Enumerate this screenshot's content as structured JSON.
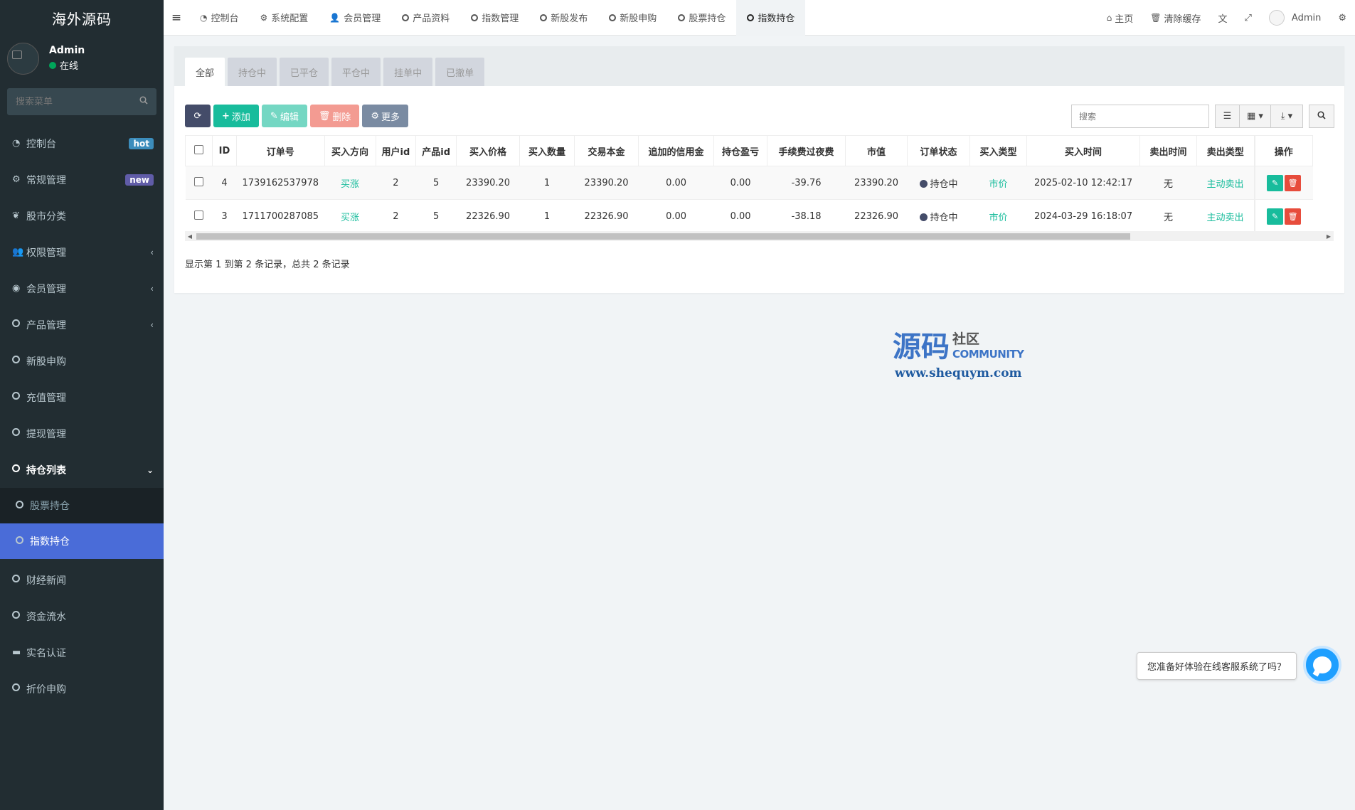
{
  "app": {
    "logo": "海外源码"
  },
  "user": {
    "name": "Admin",
    "status": "在线"
  },
  "sidebar": {
    "search_placeholder": "搜索菜单",
    "items": [
      {
        "label": "控制台",
        "badge": "hot"
      },
      {
        "label": "常规管理",
        "badge": "new"
      },
      {
        "label": "股市分类"
      },
      {
        "label": "权限管理",
        "arrow": "‹"
      },
      {
        "label": "会员管理",
        "arrow": "‹"
      },
      {
        "label": "产品管理",
        "arrow": "‹"
      },
      {
        "label": "新股申购"
      },
      {
        "label": "充值管理"
      },
      {
        "label": "提现管理"
      },
      {
        "label": "持仓列表",
        "arrow": "⌄"
      }
    ],
    "sub_items": [
      {
        "label": "股票持仓"
      },
      {
        "label": "指数持仓"
      }
    ],
    "items_after": [
      {
        "label": "财经新闻"
      },
      {
        "label": "资金流水"
      },
      {
        "label": "实名认证"
      },
      {
        "label": "折价申购"
      }
    ]
  },
  "topnav": {
    "tabs": [
      "控制台",
      "系统配置",
      "会员管理",
      "产品资料",
      "指数管理",
      "新股发布",
      "新股申购",
      "股票持仓",
      "指数持仓"
    ],
    "right": {
      "home": "主页",
      "clear_cache": "清除缓存",
      "user": "Admin"
    }
  },
  "filters": [
    "全部",
    "持仓中",
    "已平仓",
    "平仓中",
    "挂单中",
    "已撤单"
  ],
  "toolbar": {
    "add": "添加",
    "edit": "编辑",
    "delete": "删除",
    "more": "更多",
    "search_placeholder": "搜索"
  },
  "table": {
    "columns": [
      "ID",
      "订单号",
      "买入方向",
      "用户id",
      "产品id",
      "买入价格",
      "买入数量",
      "交易本金",
      "追加的信用金",
      "持仓盈亏",
      "手续费过夜费",
      "市值",
      "订单状态",
      "买入类型",
      "买入时间",
      "卖出时间",
      "卖出类型",
      "操作"
    ],
    "rows": [
      [
        "4",
        "1739162537978",
        "买涨",
        "2",
        "5",
        "23390.20",
        "1",
        "23390.20",
        "0.00",
        "0.00",
        "-39.76",
        "23390.20",
        "持仓中",
        "市价",
        "2025-02-10 12:42:17",
        "无",
        "主动卖出"
      ],
      [
        "3",
        "1711700287085",
        "买涨",
        "2",
        "5",
        "22326.90",
        "1",
        "22326.90",
        "0.00",
        "0.00",
        "-38.18",
        "22326.90",
        "持仓中",
        "市价",
        "2024-03-29 16:18:07",
        "无",
        "主动卖出"
      ]
    ]
  },
  "pagination_info": "显示第 1 到第 2 条记录，总共 2 条记录",
  "watermark": {
    "big": "源码",
    "cn": "社区",
    "en": "COMMUNITY",
    "url": "www.shequym.com"
  },
  "chat": {
    "tip": "您准备好体验在线客服系统了吗？"
  }
}
